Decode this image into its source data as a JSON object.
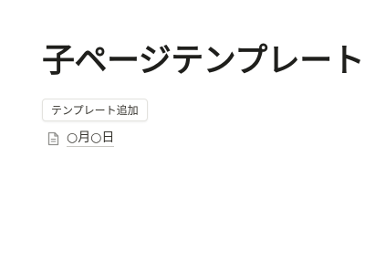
{
  "page": {
    "title": "子ページテンプレート"
  },
  "template_button": {
    "label": "テンプレート追加",
    "icon": "none"
  },
  "subpages": [
    {
      "label": "○月○日",
      "icon": "page-icon"
    }
  ],
  "colors": {
    "text": "#37352f",
    "title": "#1f1f1c",
    "button_border": "#e3e2de",
    "link_underline": "#c9c8c4",
    "background": "#ffffff"
  }
}
